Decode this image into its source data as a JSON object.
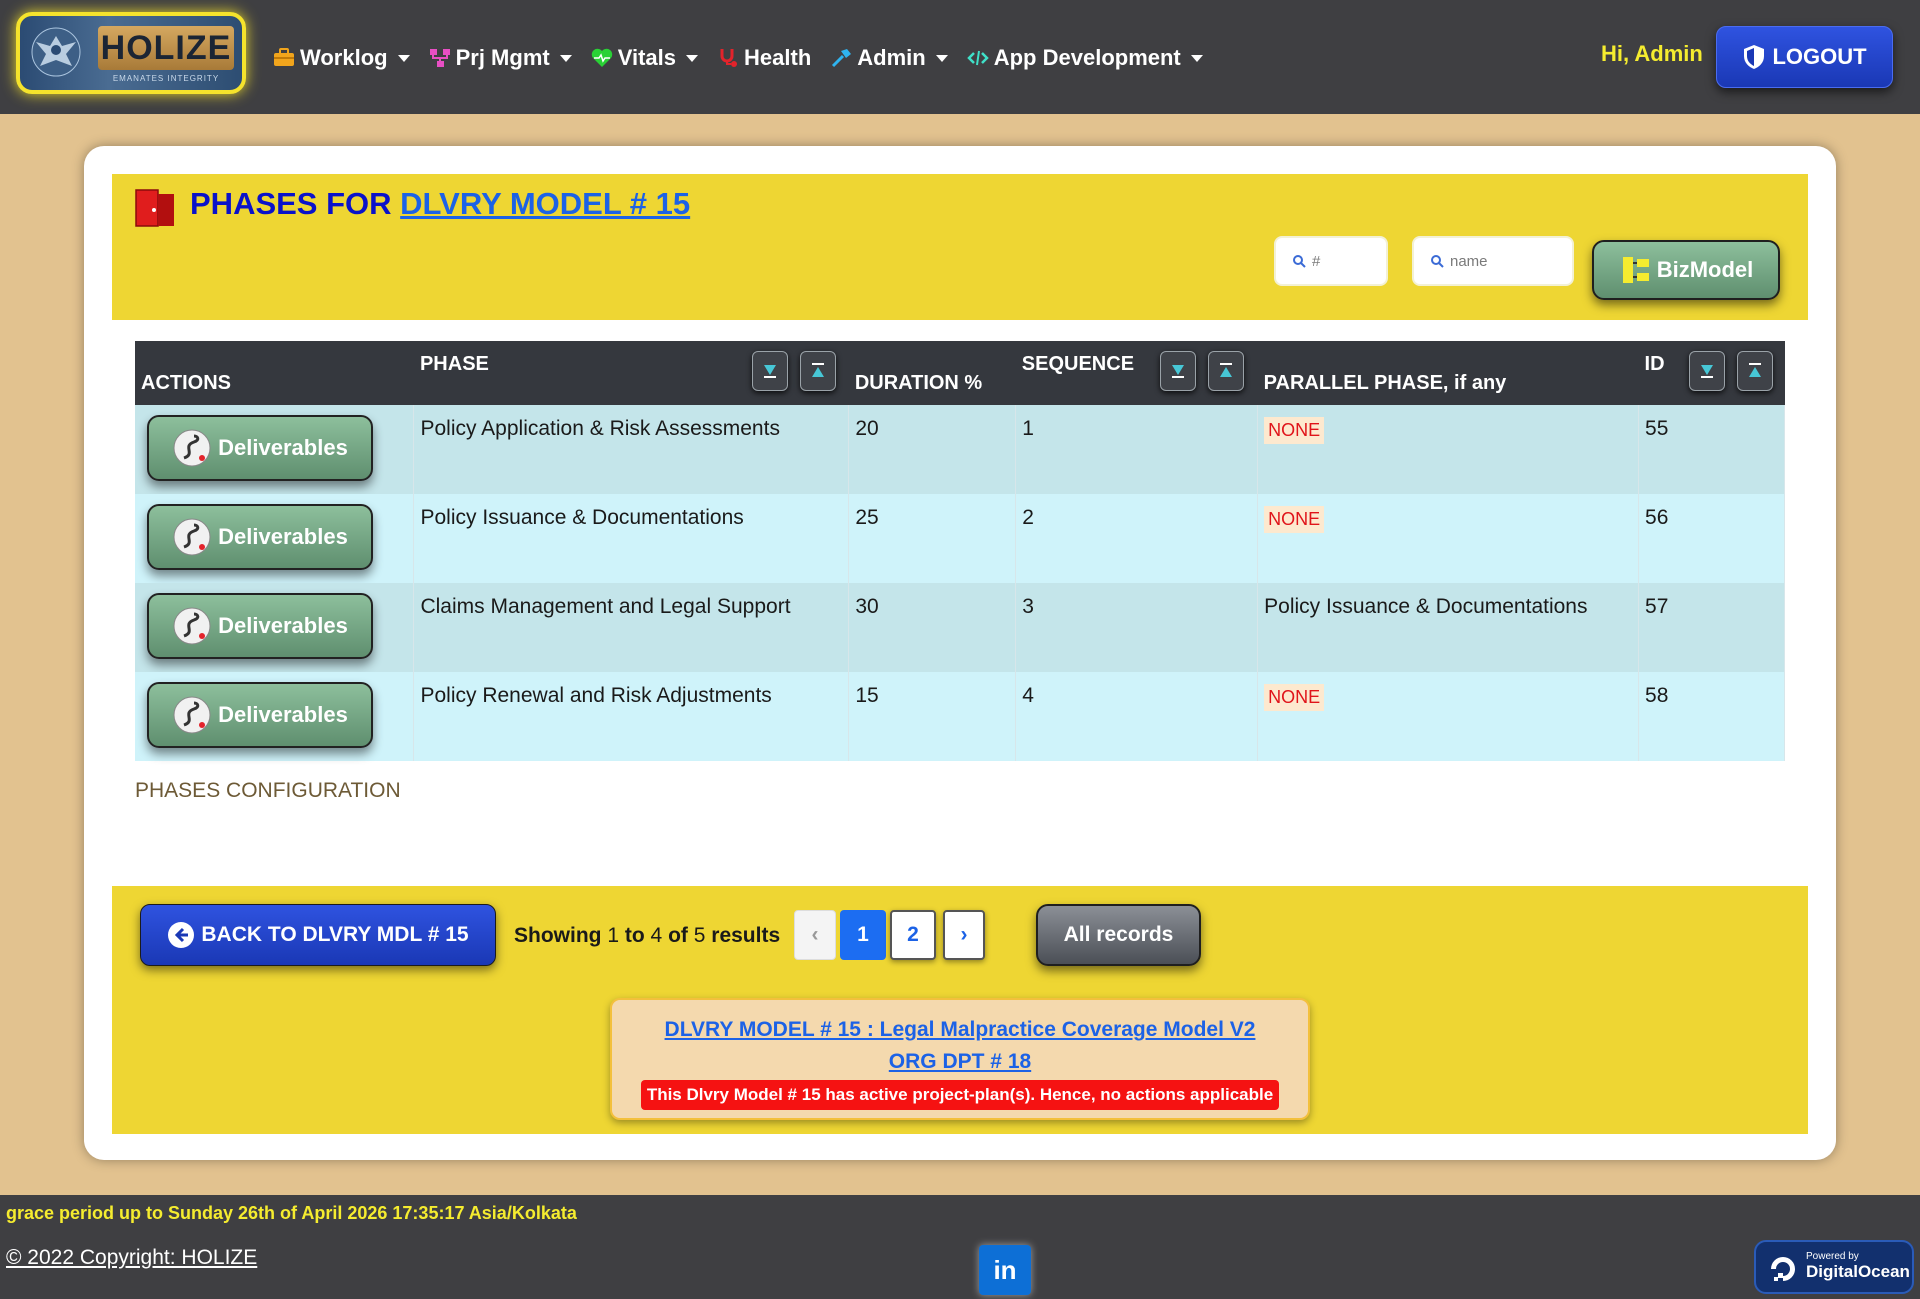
{
  "brand": {
    "name": "HOLIZE",
    "tagline": "EMANATES INTEGRITY"
  },
  "nav": [
    {
      "label": "Worklog",
      "icon": "briefcase-icon",
      "dropdown": true
    },
    {
      "label": "Prj Mgmt",
      "icon": "project-tree-icon",
      "dropdown": true
    },
    {
      "label": "Vitals",
      "icon": "heart-pulse-icon",
      "dropdown": true
    },
    {
      "label": "Health",
      "icon": "stethoscope-icon",
      "dropdown": false
    },
    {
      "label": "Admin",
      "icon": "hammer-icon",
      "dropdown": true
    },
    {
      "label": "App Development",
      "icon": "code-icon",
      "dropdown": true
    }
  ],
  "user": {
    "greeting": "Hi, Admin",
    "logout_label": "LOGOUT"
  },
  "header": {
    "title_prefix": "PHASES FOR",
    "title_link": "DLVRY MODEL # 15"
  },
  "search": {
    "id_placeholder": "#",
    "name_placeholder": "name"
  },
  "bizmodel_label": "BizModel",
  "table": {
    "columns": {
      "actions": "ACTIONS",
      "phase": "PHASE",
      "duration": "DURATION %",
      "sequence": "SEQUENCE",
      "parallel": "PARALLEL PHASE, if any",
      "id": "ID"
    },
    "action_label": "Deliverables",
    "rows": [
      {
        "phase": "Policy Application & Risk Assessments",
        "duration": "20",
        "sequence": "1",
        "parallel": "NONE",
        "id": "55"
      },
      {
        "phase": "Policy Issuance & Documentations",
        "duration": "25",
        "sequence": "2",
        "parallel": "NONE",
        "id": "56"
      },
      {
        "phase": "Claims Management and Legal Support",
        "duration": "30",
        "sequence": "3",
        "parallel": "Policy Issuance & Documentations",
        "id": "57"
      },
      {
        "phase": "Policy Renewal and Risk Adjustments",
        "duration": "15",
        "sequence": "4",
        "parallel": "NONE",
        "id": "58"
      }
    ]
  },
  "config_caption": "PHASES CONFIGURATION",
  "footer_panel": {
    "back_label": "BACK TO DLVRY MDL # 15",
    "showing_prefix": "Showing",
    "showing_from": "1",
    "showing_to_word": "to",
    "showing_to": "4",
    "showing_of_word": "of",
    "showing_total": "5",
    "showing_suffix": "results",
    "pagination": {
      "prev": "‹",
      "pages": [
        "1",
        "2"
      ],
      "next": "›",
      "current": "1"
    },
    "all_records_label": "All records",
    "model_link": "DLVRY MODEL # 15 : Legal Malpractice Coverage Model V2",
    "org_link": "ORG DPT # 18",
    "warning": "This Dlvry Model # 15 has active project-plan(s). Hence, no actions applicable"
  },
  "bottom": {
    "grace": "grace period up to Sunday 26th of April 2026 17:35:17 Asia/Kolkata",
    "copyright": "© 2022 Copyright: HOLIZE",
    "linkedin": "in",
    "do_powered": "Powered by",
    "do_name": "DigitalOcean"
  },
  "colors": {
    "accent_yellow": "#eed633",
    "nav_bg": "#3f3f42",
    "page_bg": "#e2c28f",
    "link_blue": "#1c62e6",
    "title_blue": "#0a12c9",
    "none_red": "#e0141a"
  }
}
